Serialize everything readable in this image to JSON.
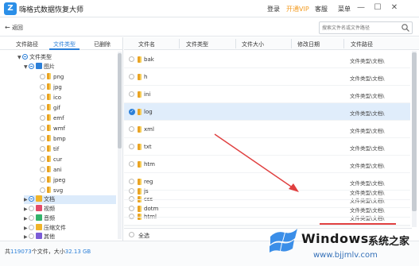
{
  "app": {
    "title": "嗨格式数据恢复大师",
    "logo_letter": "Z"
  },
  "title_menu": {
    "login": "登录",
    "vip": "开通VIP",
    "service": "客服",
    "menu": "菜单"
  },
  "window_controls": {
    "minimize": "—",
    "maximize": "☐",
    "close": "✕"
  },
  "toolbar": {
    "back_label": "返回",
    "search_placeholder": "搜索文件名或文件路径"
  },
  "sidebar": {
    "tabs": [
      {
        "label": "文件路径"
      },
      {
        "label": "文件类型"
      },
      {
        "label": "已删除"
      }
    ],
    "active_tab": "文件类型",
    "tree": {
      "root": "文件类型",
      "pictures": "图片",
      "picture_types": [
        "png",
        "jpg",
        "ico",
        "gif",
        "emf",
        "wmf",
        "bmp",
        "tif",
        "cur",
        "ani",
        "jpeg",
        "svg"
      ],
      "documents": "文档",
      "videos": "视频",
      "audio": "音频",
      "archives": "压缩文件",
      "other": "其他"
    }
  },
  "table": {
    "headers": {
      "name": "文件名",
      "type": "文件类型",
      "size": "文件大小",
      "modified": "修改日期",
      "path": "文件路径"
    },
    "rows": [
      {
        "name": "bak",
        "path": "文件类型\\文档\\",
        "selected": false
      },
      {
        "name": "h",
        "path": "文件类型\\文档\\",
        "selected": false
      },
      {
        "name": "ini",
        "path": "文件类型\\文档\\",
        "selected": false
      },
      {
        "name": "log",
        "path": "文件类型\\文档\\",
        "selected": true
      },
      {
        "name": "xml",
        "path": "文件类型\\文档\\",
        "selected": false
      },
      {
        "name": "txt",
        "path": "文件类型\\文档\\",
        "selected": false
      },
      {
        "name": "htm",
        "path": "文件类型\\文档\\",
        "selected": false
      },
      {
        "name": "reg",
        "path": "文件类型\\文档\\",
        "selected": false
      },
      {
        "name": "css",
        "path": "文件类型\\文档\\",
        "selected": false
      },
      {
        "name": "html",
        "path": "文件类型\\文档\\",
        "selected": false
      },
      {
        "name": "js",
        "path": "文件类型\\文档\\",
        "selected": false
      },
      {
        "name": "dotm",
        "path": "文件类型\\文档\\",
        "selected": false
      }
    ],
    "select_all": "全选"
  },
  "status": {
    "prefix": "共",
    "count": "119073",
    "middle": "个文件，大小",
    "size": "32.13 GB"
  },
  "watermark": {
    "brand": "Windows",
    "cn": "系统之家",
    "url": "www.bjjmlv.com"
  },
  "colors": {
    "accent": "#2b7fd8",
    "vip": "#f39a1e",
    "overlay_red": "#e04040"
  }
}
